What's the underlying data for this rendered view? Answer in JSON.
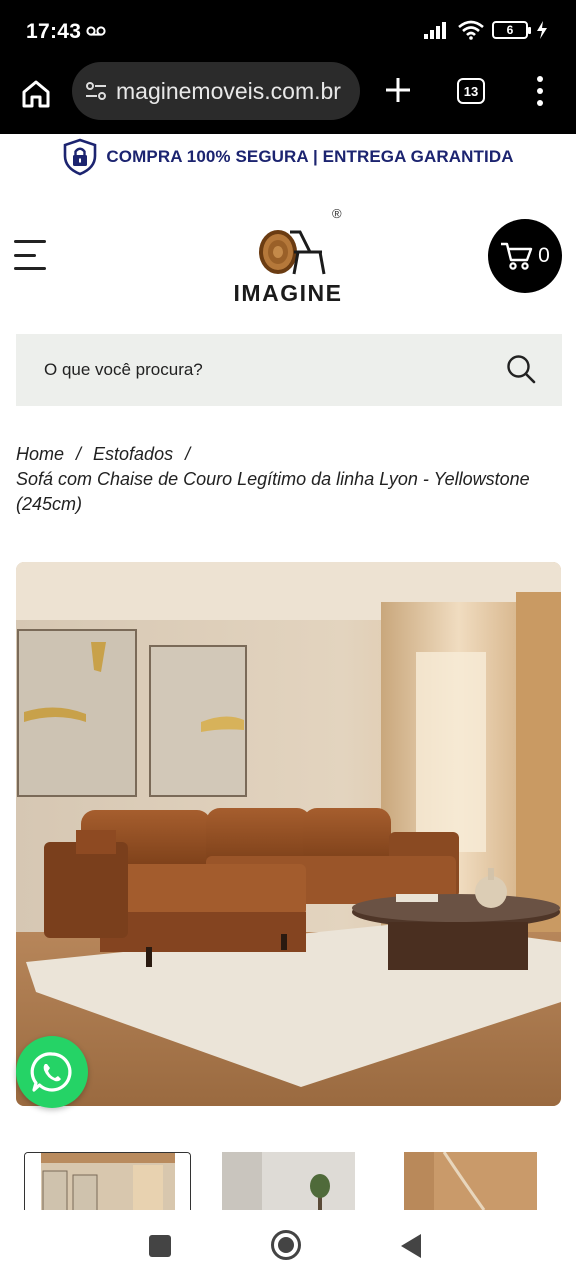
{
  "status_bar": {
    "time": "17:43",
    "battery": "6",
    "icons": [
      "voicemail-icon",
      "signal-icon",
      "wifi-icon",
      "battery-icon",
      "charging-icon"
    ]
  },
  "browser": {
    "url": "imaginemoveis.com.br",
    "url_visible": "maginemoveis.com.br",
    "tab_count": "13"
  },
  "banner": {
    "text": "COMPRA 100% SEGURA | ENTREGA GARANTIDA",
    "color": "#1c2470"
  },
  "header": {
    "logo_text": "IMAGINE",
    "logo_reg": "®",
    "cart_count": "0"
  },
  "search": {
    "placeholder": "O que você procura?"
  },
  "breadcrumb": {
    "items": [
      "Home",
      "Estofados"
    ],
    "current": "Sofá com Chaise de Couro Legítimo da linha Lyon - Yellowstone (245cm)",
    "separator": "/"
  },
  "colors": {
    "search_bg": "#edefec",
    "whatsapp": "#25d366",
    "sofa": "#8b4a22"
  }
}
